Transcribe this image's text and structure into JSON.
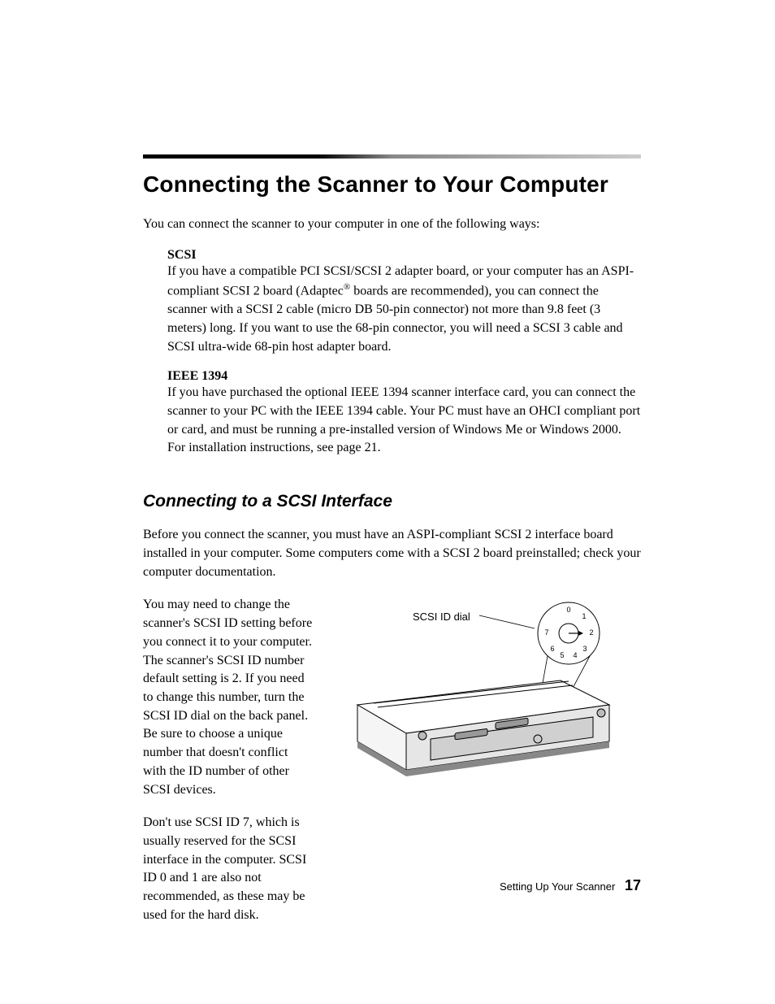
{
  "heading": "Connecting the Scanner to Your Computer",
  "intro": "You can connect the scanner to your computer in one of the following ways:",
  "scsi": {
    "title": "SCSI",
    "body_pre": "If you have a compatible PCI SCSI/SCSI 2 adapter board, or your computer has an ASPI-compliant SCSI 2 board (Adaptec",
    "reg": "®",
    "body_post": " boards are recommended), you can connect the scanner with a SCSI 2 cable (micro DB 50-pin connector) not more than 9.8 feet (3 meters) long. If you want to use the 68-pin connector, you will need a SCSI 3 cable and SCSI ultra-wide 68-pin host adapter board."
  },
  "ieee": {
    "title": "IEEE 1394",
    "body": "If you have purchased the optional IEEE 1394 scanner interface card, you can connect the scanner to your PC with the IEEE 1394 cable. Your PC must have an OHCI compliant port or card, and must be running a pre-installed version of Windows Me or Windows 2000. For installation instructions, see page 21."
  },
  "subheading": "Connecting to a SCSI Interface",
  "sub_intro": "Before you connect the scanner, you must have an ASPI-compliant SCSI 2 interface board installed in your computer. Some computers come with a SCSI 2 board preinstalled; check your computer documentation.",
  "left1": "You may need to change the scanner's SCSI ID setting before you connect it to your computer. The scanner's SCSI ID number default setting is 2. If you need to change this number, turn the SCSI ID dial on the back panel. Be sure to choose a unique number that doesn't conflict with the ID number of other SCSI devices.",
  "left2": "Don't use SCSI ID 7, which is usually reserved for the SCSI interface in the computer. SCSI ID 0 and 1 are also not recommended, as these may be used for the hard disk.",
  "figure_label": "SCSI ID dial",
  "dial_numbers": [
    "0",
    "1",
    "2",
    "3",
    "4",
    "5",
    "6",
    "7"
  ],
  "footer_section": "Setting Up Your Scanner",
  "footer_page": "17"
}
